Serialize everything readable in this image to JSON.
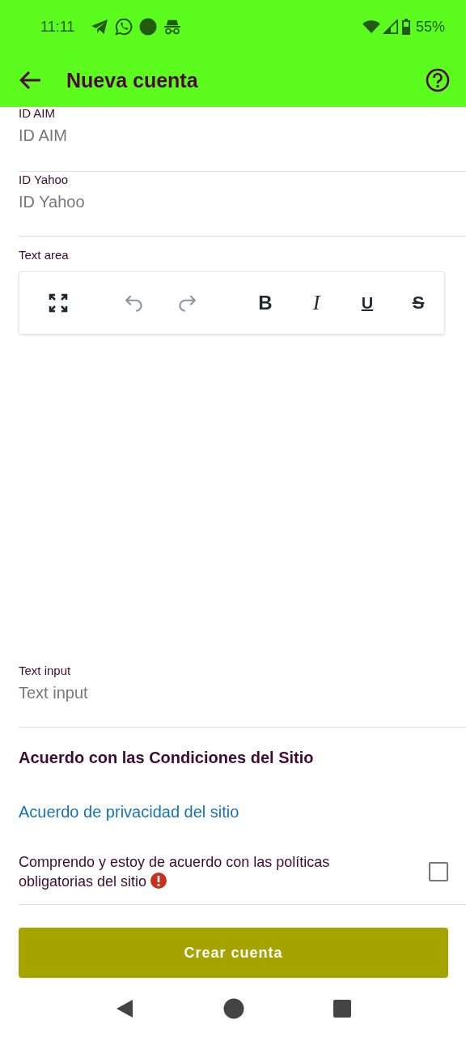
{
  "status_bar": {
    "time": "11:11",
    "battery": "55%"
  },
  "app_bar": {
    "title": "Nueva cuenta"
  },
  "fields": [
    {
      "label": "ID AIM",
      "placeholder": "ID AIM"
    },
    {
      "label": "ID Yahoo",
      "placeholder": "ID Yahoo"
    }
  ],
  "text_area": {
    "label": "Text area",
    "toolbar": [
      {
        "kind": "fullscreen",
        "disabled": false
      },
      {
        "kind": "undo",
        "disabled": true
      },
      {
        "kind": "redo",
        "disabled": true
      },
      {
        "kind": "bold",
        "label": "B",
        "disabled": false
      },
      {
        "kind": "italic",
        "label": "I",
        "disabled": false
      },
      {
        "kind": "underline",
        "label": "U",
        "disabled": false
      },
      {
        "kind": "strike",
        "label": "S",
        "disabled": false
      }
    ]
  },
  "text_input": {
    "label": "Text input",
    "placeholder": "Text input"
  },
  "terms_title": "Acuerdo con las Condiciones del Sitio",
  "privacy_link": "Acuerdo de privacidad del sitio",
  "agreement": {
    "text": "Comprendo y estoy de acuerdo con las políticas obligatorias del sitio",
    "required": true,
    "checked": false
  },
  "submit_button": "Crear cuenta"
}
